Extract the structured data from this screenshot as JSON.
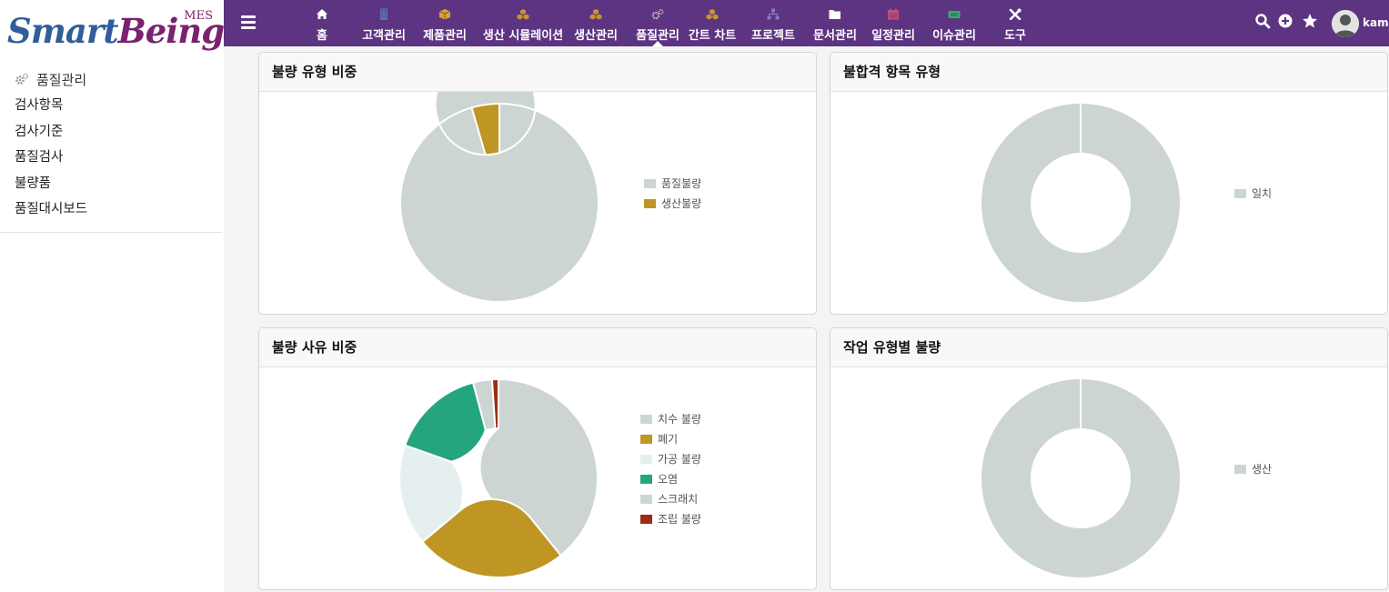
{
  "brand": {
    "name_part1": "Smart",
    "name_part2": "Being",
    "tag": "MES"
  },
  "sidebar": {
    "section_title": "품질관리",
    "items": [
      {
        "label": "검사항목"
      },
      {
        "label": "검사기준"
      },
      {
        "label": "품질검사"
      },
      {
        "label": "불량품"
      },
      {
        "label": "품질대시보드"
      }
    ]
  },
  "topnav": {
    "items": [
      {
        "label": "홈",
        "icon": "home-icon",
        "color": "#ffffff"
      },
      {
        "label": "고객관리",
        "icon": "building-icon",
        "color": "#5a6fb8"
      },
      {
        "label": "제품관리",
        "icon": "box-icon",
        "color": "#d9a520"
      },
      {
        "label": "생산 시뮬레이션",
        "icon": "cubes-icon",
        "color": "#c9952a"
      },
      {
        "label": "생산관리",
        "icon": "cubes-icon",
        "color": "#c9952a"
      },
      {
        "label": "품질관리",
        "icon": "gears-icon",
        "color": "#bdbdbd"
      },
      {
        "label": "간트 차트",
        "icon": "cubes-icon",
        "color": "#c9952a"
      },
      {
        "label": "프로젝트",
        "icon": "sitemap-icon",
        "color": "#8a7ac4"
      },
      {
        "label": "문서관리",
        "icon": "folder-icon",
        "color": "#ffffff"
      },
      {
        "label": "일정관리",
        "icon": "calendar-icon",
        "color": "#c0507a"
      },
      {
        "label": "이슈관리",
        "icon": "ticket-icon",
        "color": "#2eae6a"
      },
      {
        "label": "도구",
        "icon": "tools-icon",
        "color": "#ffffff"
      }
    ],
    "active": "품질관리"
  },
  "user": {
    "name": "kame"
  },
  "panels": [
    {
      "title": "불량 유형 비중"
    },
    {
      "title": "불합격 항목 유형"
    },
    {
      "title": "불량 사유 비중"
    },
    {
      "title": "작업 유형별 불량"
    }
  ],
  "chart_data": [
    {
      "type": "pie",
      "title": "불량 유형 비중",
      "categories": [
        "품질불량",
        "생산불량"
      ],
      "values": [
        95.5,
        4.5
      ],
      "colors": [
        "#cdd5d3",
        "#bf9524"
      ],
      "legend": "right"
    },
    {
      "type": "pie",
      "title": "불합격 항목 유형",
      "categories": [
        "일치"
      ],
      "values": [
        100
      ],
      "colors": [
        "#cdd5d3"
      ],
      "legend": "right"
    },
    {
      "type": "pie",
      "title": "불량 사유 비중",
      "categories": [
        "치수 불량",
        "폐기",
        "가공 불량",
        "오염",
        "스크래치",
        "조립 불량"
      ],
      "values": [
        38,
        24,
        16,
        15,
        3,
        1
      ],
      "colors": [
        "#cdd5d3",
        "#bf9524",
        "#e6efef",
        "#24a57e",
        "#cdd5d3",
        "#9a2e14"
      ],
      "legend": "right"
    },
    {
      "type": "pie",
      "title": "작업 유형별 불량",
      "categories": [
        "생산"
      ],
      "values": [
        100
      ],
      "colors": [
        "#cdd5d3"
      ],
      "legend": "right"
    }
  ]
}
